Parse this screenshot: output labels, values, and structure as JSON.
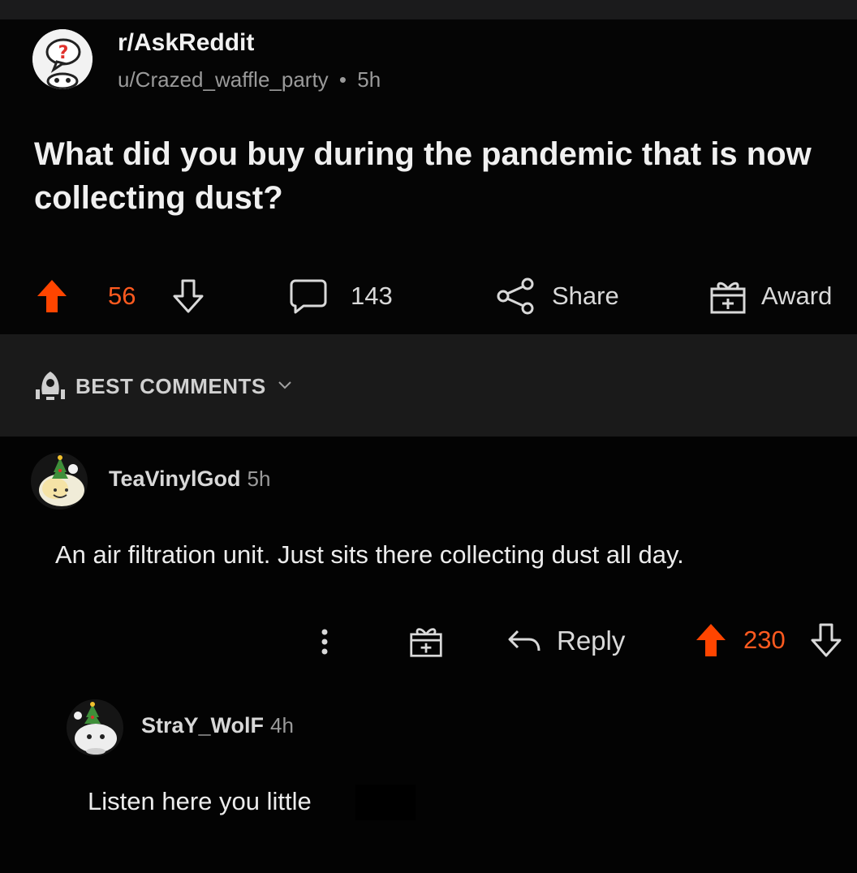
{
  "post": {
    "subreddit": "r/AskReddit",
    "author": "u/Crazed_waffle_party",
    "separator": "•",
    "age": "5h",
    "title": "What did you buy during the pandemic that is now collecting dust?",
    "upvotes": "56",
    "comments": "143",
    "share_label": "Share",
    "award_label": "Award"
  },
  "sort": {
    "label": "BEST COMMENTS"
  },
  "comments": [
    {
      "user": "TeaVinylGod",
      "age": "5h",
      "body": "An air filtration unit. Just sits there collecting dust all day.",
      "reply_label": "Reply",
      "score": "230"
    },
    {
      "user": "StraY_WolF",
      "age": "4h",
      "body": "Listen here you little"
    }
  ],
  "colors": {
    "upvote_orange": "#ff4500",
    "vote_text": "#ff5a1f",
    "background": "#000000",
    "sort_bar": "#1a1a1a"
  },
  "icons": [
    "subreddit-avatar",
    "upvote-icon",
    "downvote-icon",
    "comment-icon",
    "share-icon",
    "award-icon",
    "rocket-icon",
    "chevron-down-icon",
    "more-icon",
    "reply-icon",
    "user-avatar"
  ]
}
